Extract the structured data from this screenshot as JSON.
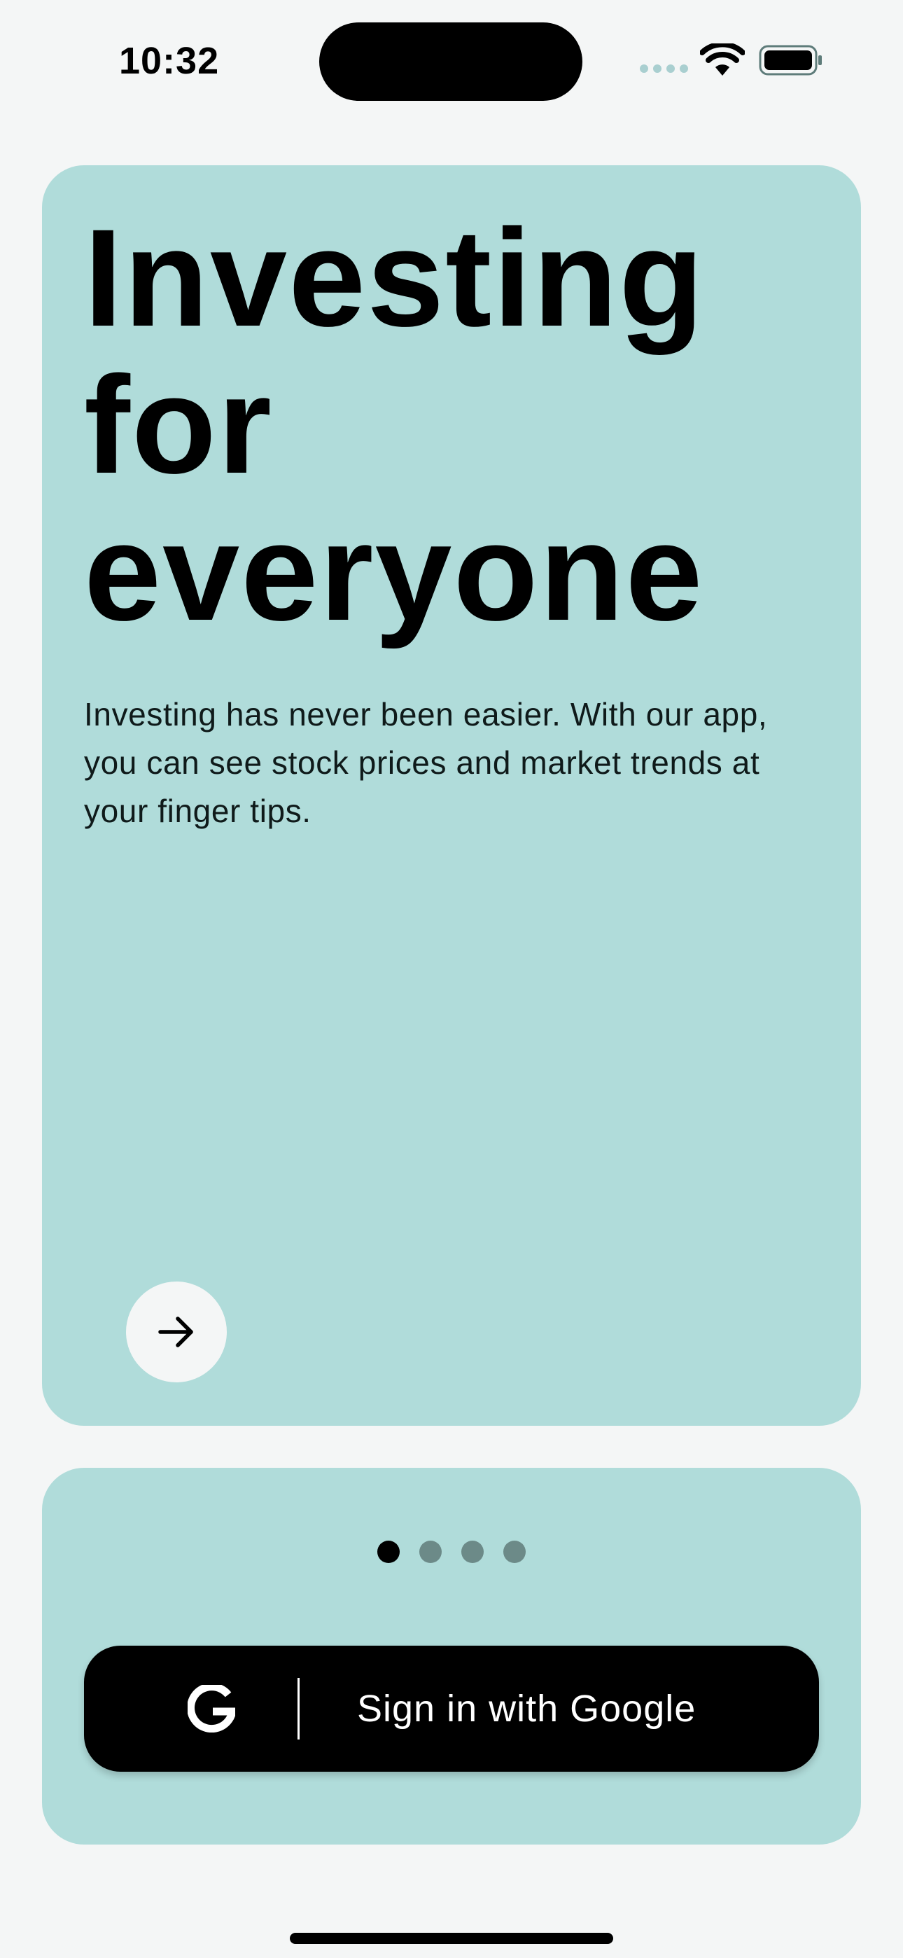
{
  "status_bar": {
    "time": "10:32"
  },
  "hero": {
    "title_lines": [
      "Investing",
      "for",
      "everyone"
    ],
    "description": "Investing has never been easier. With our app, you can see stock prices and market trends at your finger tips.",
    "next_button_icon": "arrow-right-icon"
  },
  "pager": {
    "total": 4,
    "active_index": 0
  },
  "signin": {
    "label": "Sign in with Google",
    "icon": "google-icon"
  },
  "colors": {
    "background": "#f4f6f6",
    "card": "#b0dcda",
    "primary": "#000000",
    "pager_inactive": "#6c8a88"
  }
}
